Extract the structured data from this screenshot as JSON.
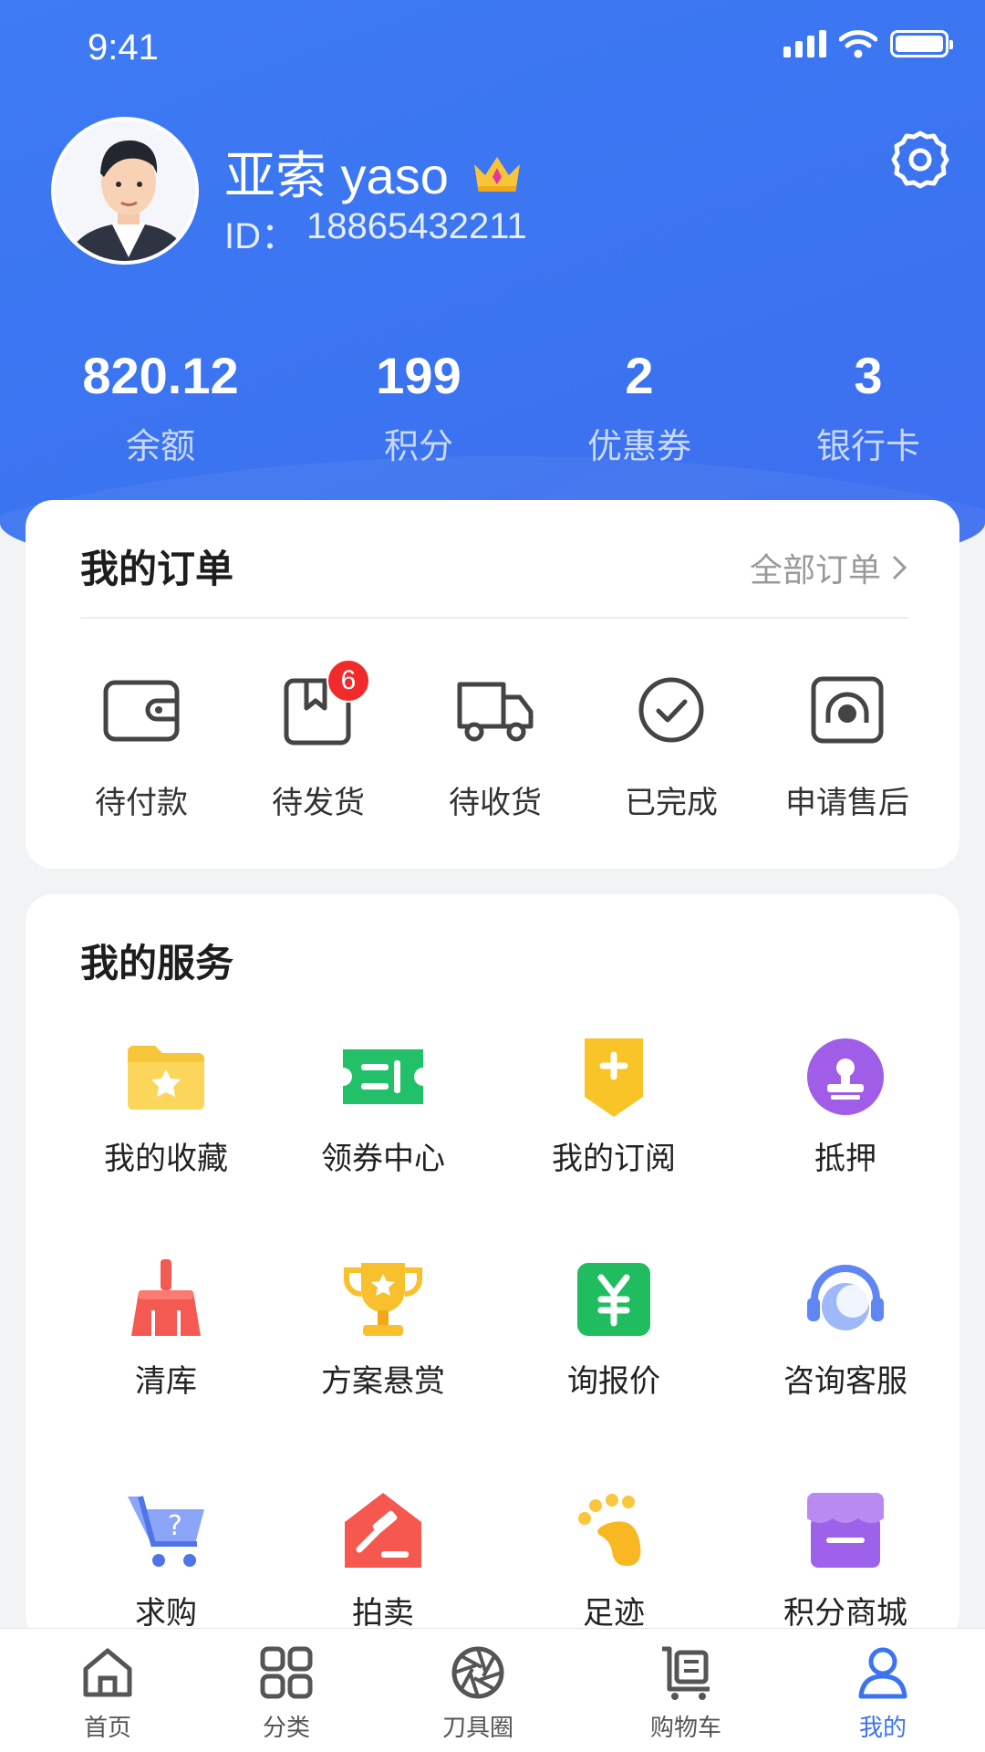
{
  "status_bar": {
    "time": "9:41"
  },
  "profile": {
    "name": "亚索 yaso",
    "id_label": "ID：",
    "id_value": "18865432211"
  },
  "stats": [
    {
      "value": "820.12",
      "label": "余额"
    },
    {
      "value": "199",
      "label": "积分"
    },
    {
      "value": "2",
      "label": "优惠券"
    },
    {
      "value": "3",
      "label": "银行卡"
    }
  ],
  "orders": {
    "title": "我的订单",
    "all_label": "全部订单",
    "items": [
      {
        "label": "待付款",
        "icon": "wallet-icon"
      },
      {
        "label": "待发货",
        "icon": "package-icon",
        "badge": "6"
      },
      {
        "label": "待收货",
        "icon": "truck-icon"
      },
      {
        "label": "已完成",
        "icon": "check-circle-icon"
      },
      {
        "label": "申请售后",
        "icon": "headset-icon"
      }
    ]
  },
  "services": {
    "title": "我的服务",
    "items": [
      {
        "label": "我的收藏",
        "icon": "folder-star-icon"
      },
      {
        "label": "领券中心",
        "icon": "coupon-icon"
      },
      {
        "label": "我的订阅",
        "icon": "subscribe-icon"
      },
      {
        "label": "抵押",
        "icon": "stamp-icon"
      },
      {
        "label": "清库",
        "icon": "broom-icon"
      },
      {
        "label": "方案悬赏",
        "icon": "trophy-icon"
      },
      {
        "label": "询报价",
        "icon": "yuan-icon"
      },
      {
        "label": "咨询客服",
        "icon": "headset-icon"
      },
      {
        "label": "求购",
        "icon": "cart-question-icon"
      },
      {
        "label": "拍卖",
        "icon": "auction-icon"
      },
      {
        "label": "足迹",
        "icon": "footprint-icon"
      },
      {
        "label": "积分商城",
        "icon": "store-icon"
      }
    ]
  },
  "tabbar": {
    "items": [
      {
        "label": "首页",
        "icon": "home-icon"
      },
      {
        "label": "分类",
        "icon": "grid-icon"
      },
      {
        "label": "刀具圈",
        "icon": "aperture-icon"
      },
      {
        "label": "购物车",
        "icon": "trolley-icon"
      },
      {
        "label": "我的",
        "icon": "user-icon",
        "active": true
      }
    ]
  },
  "colors": {
    "primary": "#3b73f0",
    "badge": "#f12b2b",
    "background": "#f2f3f5"
  }
}
